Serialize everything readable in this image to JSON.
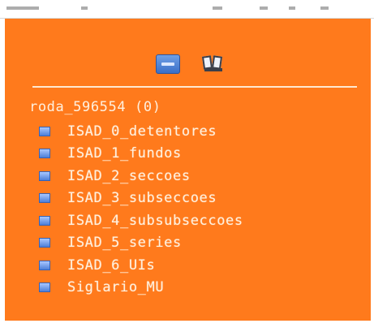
{
  "panel": {
    "background": "#ff7a1c",
    "toolbar": {
      "icons": [
        "new-item-icon",
        "open-book-icon"
      ]
    },
    "tree": {
      "root_label": "roda_596554 (0)",
      "items": [
        {
          "label": "ISAD_0_detentores",
          "icon": "folder-icon"
        },
        {
          "label": "ISAD_1_fundos",
          "icon": "folder-icon"
        },
        {
          "label": "ISAD_2_seccoes",
          "icon": "folder-icon"
        },
        {
          "label": "ISAD_3_subseccoes",
          "icon": "folder-icon"
        },
        {
          "label": "ISAD_4_subsubseccoes",
          "icon": "folder-icon"
        },
        {
          "label": "ISAD_5_series",
          "icon": "folder-icon"
        },
        {
          "label": "ISAD_6_UIs",
          "icon": "folder-icon"
        },
        {
          "label": "Siglario_MU",
          "icon": "folder-icon"
        }
      ]
    }
  }
}
